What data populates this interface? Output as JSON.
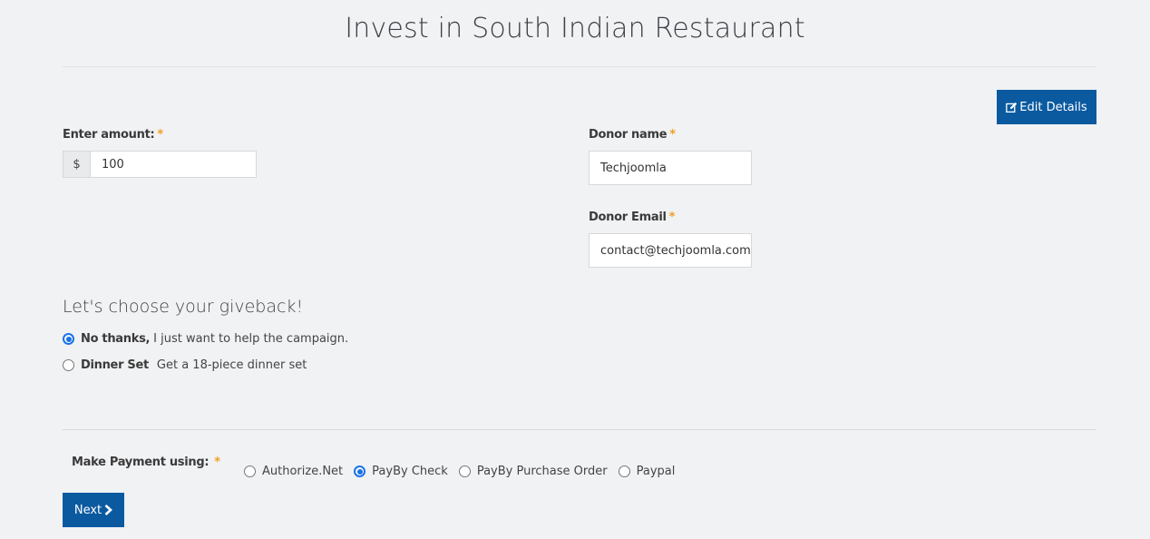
{
  "page": {
    "title": "Invest in  South Indian Restaurant"
  },
  "toolbar": {
    "edit_label": "Edit Details"
  },
  "amount": {
    "label": "Enter amount:",
    "required_mark": "*",
    "currency": "$",
    "value": "100"
  },
  "donor": {
    "name_label": "Donor name",
    "name_value": "Techjoomla",
    "email_label": "Donor Email",
    "email_value": "contact@techjoomla.com",
    "required_mark": "*"
  },
  "giveback": {
    "heading": "Let's choose your giveback!",
    "options": [
      {
        "title": "No thanks,",
        "desc": "I just want to help the campaign.",
        "selected": true
      },
      {
        "title": "Dinner Set",
        "desc": "Get a 18-piece dinner set",
        "selected": false
      }
    ]
  },
  "payment": {
    "label": "Make Payment using:",
    "required_mark": "*",
    "options": [
      {
        "label": "Authorize.Net",
        "selected": false
      },
      {
        "label": "PayBy Check",
        "selected": true
      },
      {
        "label": "PayBy Purchase Order",
        "selected": false
      },
      {
        "label": "Paypal",
        "selected": false
      }
    ]
  },
  "footer": {
    "next_label": "Next"
  },
  "colors": {
    "primary": "#0b5aa0",
    "required": "#f0a020",
    "radio_selected": "#1a73e8",
    "background": "#f1f2f4"
  },
  "icons": {
    "edit": "edit-icon",
    "next": "chevron-right-icon"
  }
}
